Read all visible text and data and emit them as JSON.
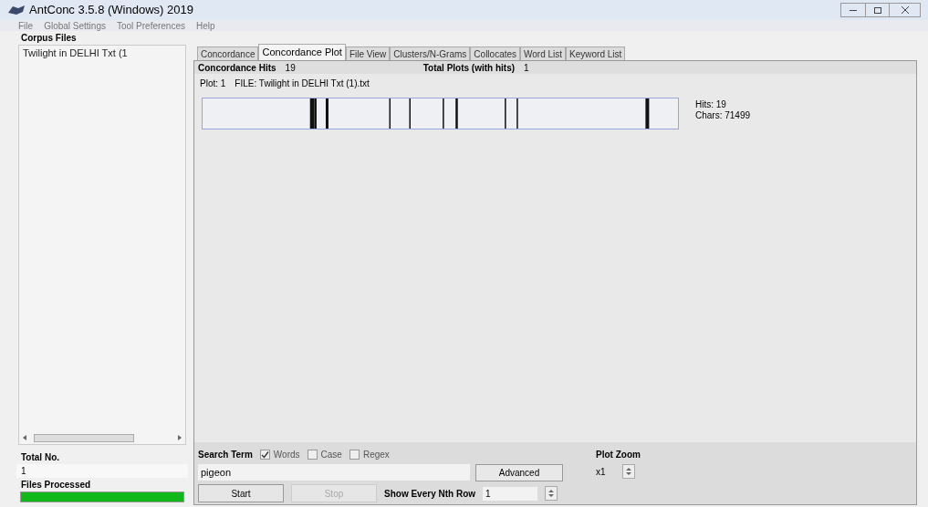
{
  "window": {
    "title": "AntConc 3.5.8 (Windows) 2019"
  },
  "menu": [
    "File",
    "Global Settings",
    "Tool Preferences",
    "Help"
  ],
  "corpus_files": {
    "heading": "Corpus Files",
    "items": [
      "Twilight in DELHI Txt (1"
    ]
  },
  "totals": {
    "total_label": "Total No.",
    "total_value": "1",
    "processed_label": "Files Processed",
    "level": 1
  },
  "tabs": [
    {
      "label": "Concordance",
      "selected": false
    },
    {
      "label": "Concordance Plot",
      "selected": true
    },
    {
      "label": "File View",
      "selected": false
    },
    {
      "label": "Clusters/N-Grams",
      "selected": false
    },
    {
      "label": "Collocates",
      "selected": false
    },
    {
      "label": "Word List",
      "selected": false
    },
    {
      "label": "Keyword List",
      "selected": false
    }
  ],
  "summary": {
    "hits_label": "Concordance Hits",
    "hits_value": "19",
    "plots_label": "Total Plots (with hits)",
    "plots_value": "1"
  },
  "plot": {
    "plot_label": "Plot: 1",
    "file_label": "FILE: Twilight in DELHI Txt (1).txt",
    "hits": "Hits: 19",
    "chars": "Chars: 71499"
  },
  "search": {
    "label": "Search Term",
    "options": [
      {
        "label": "Words",
        "checked": true
      },
      {
        "label": "Case",
        "checked": false
      },
      {
        "label": "Regex",
        "checked": false
      }
    ],
    "value": "pigeon",
    "advanced": "Advanced",
    "start": "Start",
    "stop": "Stop",
    "stop_disabled": true,
    "nth_label": "Show Every Nth Row",
    "nth_value": "1"
  },
  "zoom": {
    "label": "Plot Zoom",
    "value": "x1"
  }
}
